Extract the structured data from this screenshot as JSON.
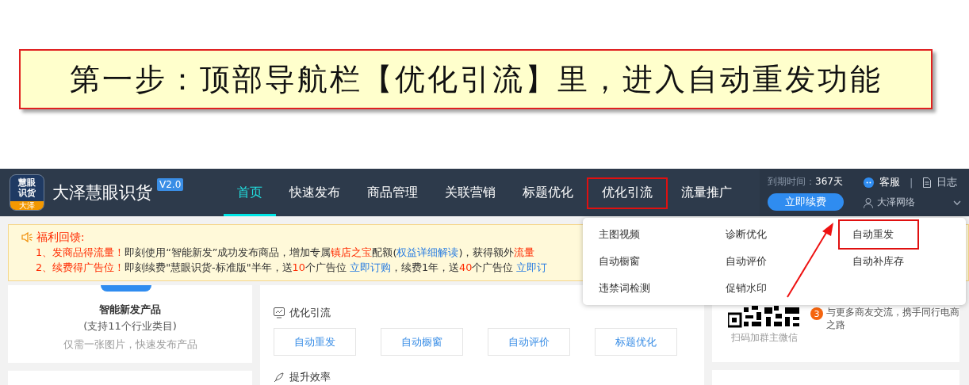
{
  "caption": "第一步：顶部导航栏【优化引流】里，进入自动重发功能",
  "header": {
    "logo": {
      "lines": [
        "慧眼",
        "识货"
      ],
      "tag": "大泽"
    },
    "title": "大泽慧眼识货",
    "version": "V2.0",
    "nav": [
      {
        "label": "首页",
        "selected": true,
        "highlighted": false
      },
      {
        "label": "快速发布",
        "selected": false,
        "highlighted": false
      },
      {
        "label": "商品管理",
        "selected": false,
        "highlighted": false
      },
      {
        "label": "关联营销",
        "selected": false,
        "highlighted": false
      },
      {
        "label": "标题优化",
        "selected": false,
        "highlighted": false
      },
      {
        "label": "优化引流",
        "selected": false,
        "highlighted": true
      },
      {
        "label": "流量推广",
        "selected": false,
        "highlighted": false
      }
    ],
    "expiry_label": "到期时间：",
    "expiry_value": "367天",
    "renew_button": "立即续费",
    "service": "客服",
    "log": "日志",
    "separator": "|",
    "account": "大泽网络"
  },
  "notice": {
    "title": "福利回馈:",
    "lines": [
      [
        {
          "kind": "highlight",
          "text": "1、发商品得流量！"
        },
        {
          "kind": "plain",
          "text": "即刻使用“智能新发”成功发布商品，增加专属"
        },
        {
          "kind": "highlight",
          "text": "镇店之宝"
        },
        {
          "kind": "plain",
          "text": "配额("
        },
        {
          "kind": "link",
          "text": "权益详细解读"
        },
        {
          "kind": "plain",
          "text": ")，获得额外"
        },
        {
          "kind": "highlight",
          "text": "流量"
        }
      ],
      [
        {
          "kind": "highlight",
          "text": "2、续费得广告位！"
        },
        {
          "kind": "plain",
          "text": "即刻续费\"慧眼识货-标准版\"半年，送"
        },
        {
          "kind": "highlight",
          "text": "10"
        },
        {
          "kind": "plain",
          "text": "个广告位 "
        },
        {
          "kind": "link",
          "text": "立即订购"
        },
        {
          "kind": "plain",
          "text": "，续费1年，送"
        },
        {
          "kind": "highlight",
          "text": "40"
        },
        {
          "kind": "plain",
          "text": "个广告位 "
        },
        {
          "kind": "link",
          "text": "立即订"
        }
      ]
    ]
  },
  "dropdown": [
    {
      "label": "主图视频",
      "highlighted": false
    },
    {
      "label": "诊断优化",
      "highlighted": false
    },
    {
      "label": "自动重发",
      "highlighted": true
    },
    {
      "label": "自动橱窗",
      "highlighted": false
    },
    {
      "label": "自动评价",
      "highlighted": false
    },
    {
      "label": "自动补库存",
      "highlighted": false
    },
    {
      "label": "违禁词检测",
      "highlighted": false
    },
    {
      "label": "促销水印",
      "highlighted": false
    }
  ],
  "new_product_card": {
    "title": "智能新发产品",
    "subtitle": "(支持11个行业类目)",
    "description": "仅需一张图片，快速发布产品"
  },
  "tools_panel": {
    "section_title": "优化引流",
    "buttons": [
      "自动重发",
      "自动橱窗",
      "自动评价",
      "标题优化"
    ],
    "next_section_title": "提升效率"
  },
  "community_card": {
    "qr_caption": "扫码加群主微信",
    "badge": "3",
    "text": "与更多商友交流，携手同行电商之路"
  }
}
